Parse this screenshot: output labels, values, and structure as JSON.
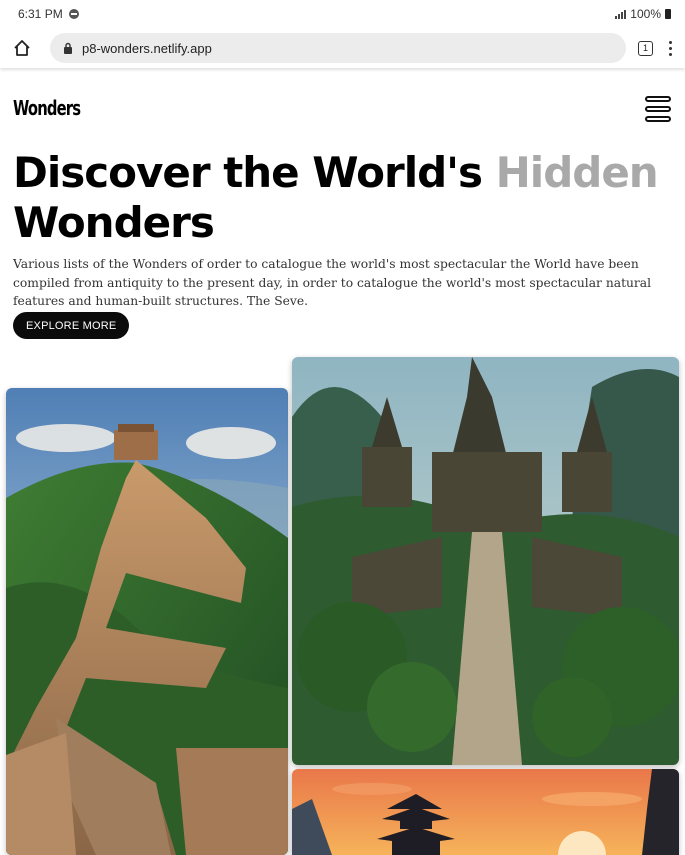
{
  "status_bar": {
    "time": "6:31 PM",
    "battery": "100%"
  },
  "browser": {
    "url": "p8-wonders.netlify.app",
    "tab_count": "1"
  },
  "site": {
    "logo": "Wonders"
  },
  "hero": {
    "title_main": "Discover the World's ",
    "title_muted": "Hidden",
    "title_line2": "Wonders",
    "description": "Various lists of the Wonders of order to catalogue the world's most spectacular the World have been compiled from antiquity to the present day, in order to catalogue the world's most spectacular natural features and human-built structures. The Seve.",
    "cta_label": "EXPLORE MORE"
  },
  "gallery": {
    "images": [
      {
        "name": "great-wall-image"
      },
      {
        "name": "jungle-temple-image"
      },
      {
        "name": "sunset-pagoda-image"
      }
    ]
  },
  "colors": {
    "text": "#000000",
    "muted": "#a9a9a9",
    "button_bg": "#0b0b0b",
    "url_bg": "#ececec"
  }
}
